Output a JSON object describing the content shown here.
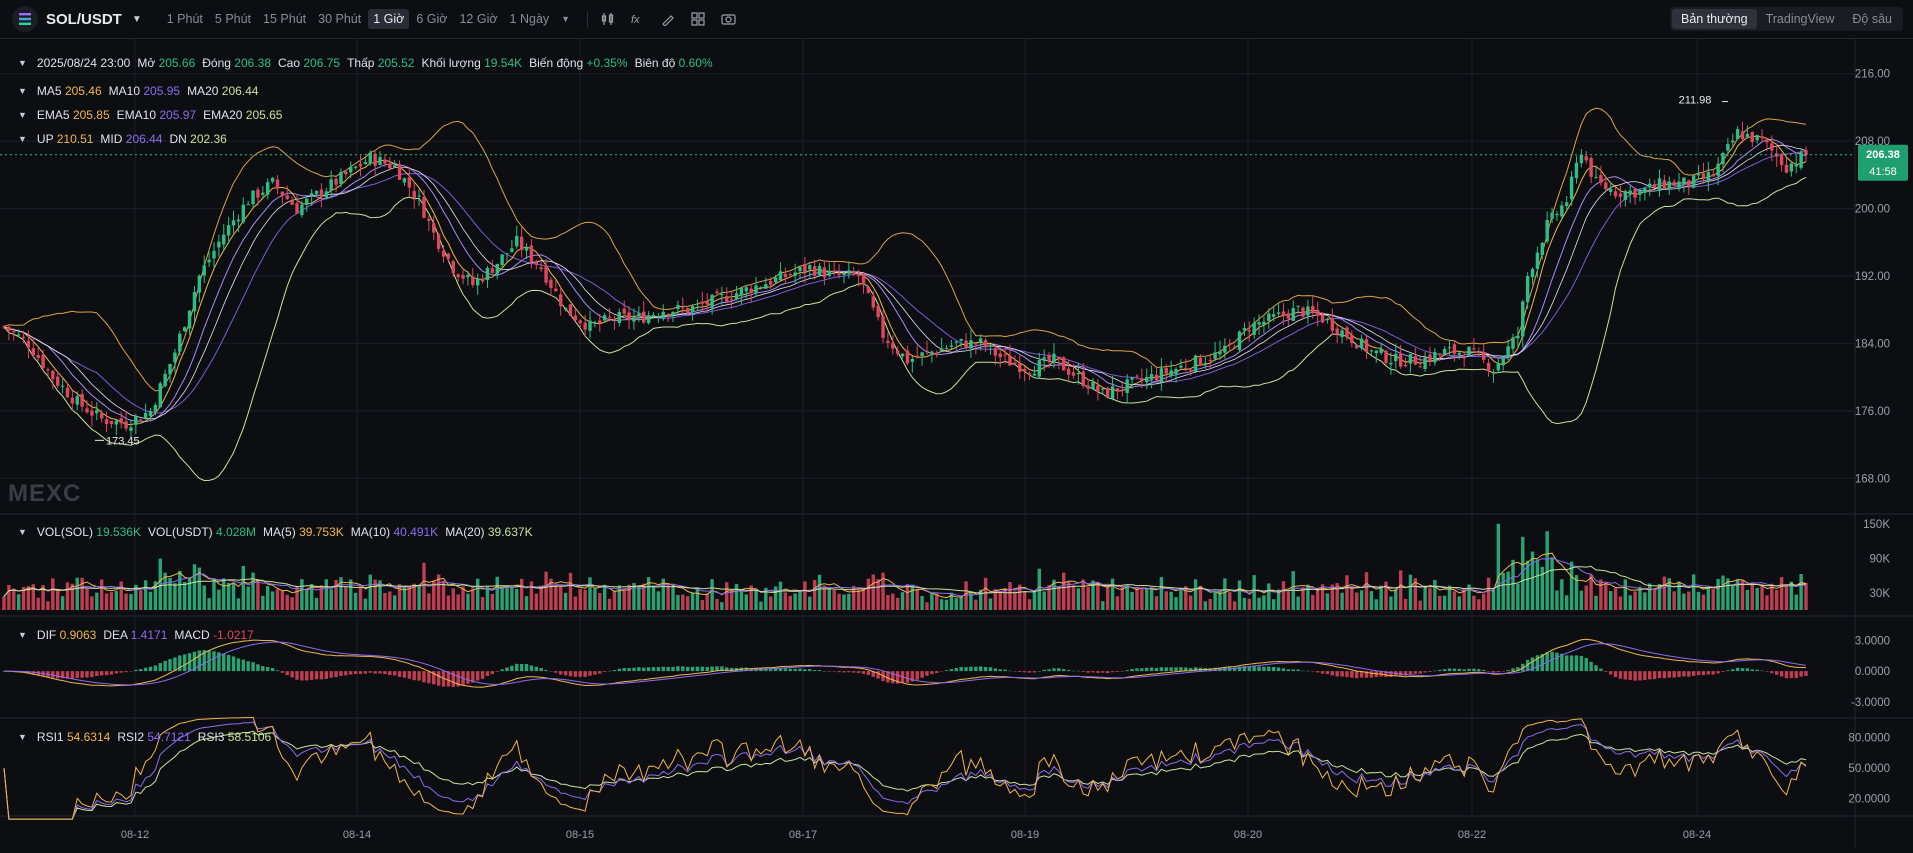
{
  "topbar": {
    "symbol": "SOL/USDT",
    "intervals": [
      "1 Phút",
      "5 Phút",
      "15 Phút",
      "30 Phút",
      "1 Giờ",
      "6 Giờ",
      "12 Giờ",
      "1 Ngày"
    ],
    "active_interval": "1 Giờ",
    "modes": [
      "Bản thường",
      "TradingView",
      "Độ sâu"
    ],
    "active_mode": "Bản thường",
    "tool_icons": [
      "candle-type-icon",
      "indicator-icon",
      "draw-icon",
      "layout-icon",
      "camera-icon"
    ]
  },
  "ohlc": {
    "date": "2025/08/24 23:00",
    "open_label": "Mở",
    "open": "205.66",
    "close_label": "Đóng",
    "close": "206.38",
    "high_label": "Cao",
    "high": "206.75",
    "low_label": "Thấp",
    "low": "205.52",
    "volume_label": "Khối lượng",
    "volume": "19.54K",
    "change_label": "Biến động",
    "change": "+0.35%",
    "amplitude_label": "Biên độ",
    "amplitude": "0.60%"
  },
  "ma": {
    "ma5_label": "MA5",
    "ma5": "205.46",
    "ma10_label": "MA10",
    "ma10": "205.95",
    "ma20_label": "MA20",
    "ma20": "206.44"
  },
  "ema": {
    "ema5_label": "EMA5",
    "ema5": "205.85",
    "ema10_label": "EMA10",
    "ema10": "205.97",
    "ema20_label": "EMA20",
    "ema20": "205.65"
  },
  "boll": {
    "up_label": "UP",
    "up": "210.51",
    "mid_label": "MID",
    "mid": "206.44",
    "dn_label": "DN",
    "dn": "202.36"
  },
  "vol": {
    "sol_label": "VOL(SOL)",
    "sol": "19.536K",
    "usdt_label": "VOL(USDT)",
    "usdt": "4.028M",
    "ma5_label": "MA(5)",
    "ma5": "39.753K",
    "ma10_label": "MA(10)",
    "ma10": "40.491K",
    "ma20_label": "MA(20)",
    "ma20": "39.637K"
  },
  "macd": {
    "dif_label": "DIF",
    "dif": "0.9063",
    "dea_label": "DEA",
    "dea": "1.4171",
    "macd_label": "MACD",
    "macd": "-1.0217"
  },
  "rsi": {
    "rsi1_label": "RSI1",
    "rsi1": "54.6314",
    "rsi2_label": "RSI2",
    "rsi2": "54.7121",
    "rsi3_label": "RSI3",
    "rsi3": "58.5106"
  },
  "price_tag": {
    "price": "206.38",
    "countdown": "41:58"
  },
  "annotations": {
    "high": "211.98",
    "low": "173.45"
  },
  "watermark": "MEXC",
  "colors": {
    "up": "#2ebd85",
    "down": "#e0475e",
    "ma5": "#f0b64a",
    "ma10": "#8c6cf0",
    "ma20": "#c9e39a",
    "boll": "#f0b64a",
    "grid": "#1c1f26"
  },
  "chart_data": {
    "type": "candlestick",
    "main": {
      "y_ticks": [
        "216.00",
        "208.00",
        "200.00",
        "192.00",
        "184.00",
        "176.00",
        "168.00"
      ],
      "ylim": [
        164,
        220
      ],
      "x_ticks": [
        "08-12",
        "08-14",
        "08-15",
        "08-17",
        "08-19",
        "08-20",
        "08-22",
        "08-24"
      ],
      "close_path": [
        [
          0,
          186
        ],
        [
          5,
          184
        ],
        [
          10,
          180
        ],
        [
          15,
          177
        ],
        [
          20,
          175
        ],
        [
          25,
          174.5
        ],
        [
          30,
          176
        ],
        [
          35,
          183
        ],
        [
          40,
          192
        ],
        [
          45,
          197
        ],
        [
          50,
          201
        ],
        [
          55,
          203
        ],
        [
          60,
          200
        ],
        [
          65,
          202
        ],
        [
          70,
          204
        ],
        [
          75,
          206
        ],
        [
          80,
          205
        ],
        [
          85,
          201
        ],
        [
          88,
          197
        ],
        [
          92,
          193
        ],
        [
          96,
          191
        ],
        [
          100,
          193
        ],
        [
          105,
          196
        ],
        [
          110,
          193
        ],
        [
          115,
          188
        ],
        [
          120,
          186
        ],
        [
          125,
          187
        ],
        [
          130,
          187
        ],
        [
          135,
          188
        ],
        [
          140,
          188
        ],
        [
          145,
          189
        ],
        [
          150,
          190
        ],
        [
          155,
          191
        ],
        [
          160,
          192
        ],
        [
          165,
          193
        ],
        [
          170,
          192
        ],
        [
          175,
          192
        ],
        [
          180,
          185
        ],
        [
          185,
          182
        ],
        [
          190,
          183
        ],
        [
          195,
          184
        ],
        [
          200,
          184
        ],
        [
          205,
          182
        ],
        [
          210,
          181
        ],
        [
          215,
          182
        ],
        [
          220,
          180
        ],
        [
          225,
          178
        ],
        [
          230,
          179
        ],
        [
          235,
          180
        ],
        [
          240,
          181
        ],
        [
          245,
          182
        ],
        [
          250,
          183
        ],
        [
          255,
          186
        ],
        [
          260,
          187
        ],
        [
          265,
          188
        ],
        [
          270,
          187
        ],
        [
          275,
          185
        ],
        [
          280,
          183
        ],
        [
          285,
          182
        ],
        [
          290,
          182
        ],
        [
          295,
          183
        ],
        [
          300,
          183
        ],
        [
          305,
          181
        ],
        [
          310,
          185
        ],
        [
          312,
          192
        ],
        [
          316,
          198
        ],
        [
          320,
          201
        ],
        [
          323,
          207
        ],
        [
          326,
          203
        ],
        [
          330,
          202
        ],
        [
          335,
          202
        ],
        [
          340,
          203
        ],
        [
          345,
          203
        ],
        [
          350,
          204
        ],
        [
          355,
          209
        ],
        [
          360,
          208
        ],
        [
          365,
          205
        ],
        [
          369,
          206.38
        ]
      ]
    },
    "volume": {
      "y_ticks": [
        "150K",
        "90K",
        "30K"
      ],
      "ylim": [
        0,
        160
      ]
    },
    "macd": {
      "y_ticks": [
        "3.0000",
        "0.0000",
        "-3.0000"
      ],
      "ylim": [
        -4,
        5
      ]
    },
    "rsi": {
      "y_ticks": [
        "80.0000",
        "50.0000",
        "20.0000"
      ],
      "ylim": [
        5,
        95
      ]
    }
  }
}
